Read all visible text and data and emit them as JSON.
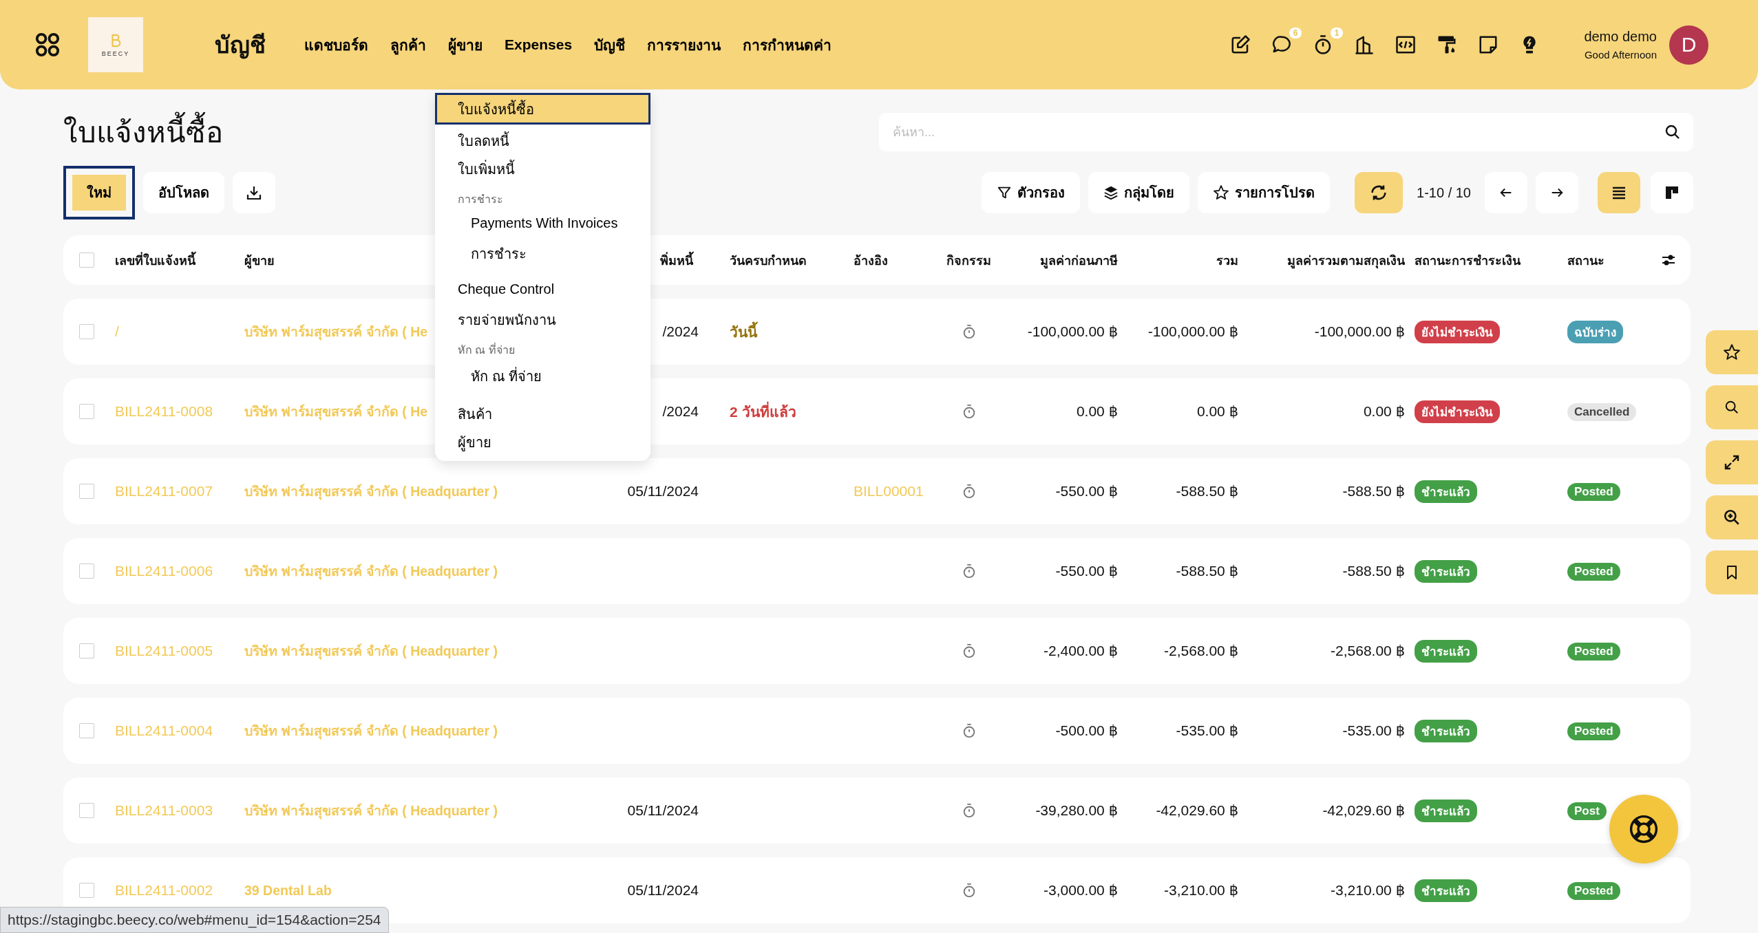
{
  "app_bar": {
    "logo_text": "BEECY",
    "app_name": "บัญชี",
    "nav": [
      {
        "label": "แดชบอร์ด"
      },
      {
        "label": "ลูกค้า"
      },
      {
        "label": "ผู้ขาย"
      },
      {
        "label": "Expenses"
      },
      {
        "label": "บัญชี"
      },
      {
        "label": "การรายงาน"
      },
      {
        "label": "การกำหนดค่า"
      }
    ],
    "tools": [
      {
        "kind": "edit"
      },
      {
        "kind": "chat",
        "badge": "6"
      },
      {
        "kind": "timer",
        "badge": "1"
      },
      {
        "kind": "building"
      },
      {
        "kind": "code"
      },
      {
        "kind": "roller"
      },
      {
        "kind": "note"
      },
      {
        "kind": "bulb"
      }
    ],
    "user": {
      "name": "demo demo",
      "greeting": "Good Afternoon",
      "initial": "D"
    }
  },
  "vendor_menu": [
    {
      "kind": "item",
      "label": "ใบแจ้งหนี้ซื้อ",
      "selected": true
    },
    {
      "kind": "item",
      "label": "ใบลดหนี้",
      "selected": false
    },
    {
      "kind": "item",
      "label": "ใบเพิ่มหนี้",
      "selected": false
    },
    {
      "kind": "section",
      "label": "การชำระ",
      "children": [
        {
          "label": "Payments With Invoices",
          "selected": false
        },
        {
          "label": "การชำระ",
          "selected": false
        }
      ]
    },
    {
      "kind": "item",
      "label": "Cheque Control",
      "selected": false
    },
    {
      "kind": "item",
      "label": "รายจ่ายพนักงาน",
      "selected": false
    },
    {
      "kind": "section",
      "label": "หัก ณ ที่จ่าย",
      "children": [
        {
          "label": "หัก ณ ที่จ่าย",
          "selected": false
        }
      ]
    },
    {
      "kind": "item",
      "label": "สินค้า",
      "selected": false
    },
    {
      "kind": "item",
      "label": "ผู้ขาย",
      "selected": false
    }
  ],
  "page": {
    "title": "ใบแจ้งหนี้ซื้อ",
    "new_button": {
      "label": "ใหม่",
      "focused": true
    },
    "upload_button": "อัปโหลด",
    "search": {
      "placeholder": "ค้นหา..."
    },
    "filter": "ตัวกรอง",
    "group_by": "กลุ่มโดย",
    "favorites": "รายการโปรด",
    "pager": "1-10 / 10",
    "views": [
      {
        "kind": "list",
        "selected": true
      },
      {
        "kind": "kanban",
        "selected": false
      }
    ]
  },
  "table": {
    "all_checked": false,
    "columns": [
      "เลขที่ใบแจ้งหนี้",
      "ผู้ขาย",
      "พิ่มหนี้",
      "วันครบกำหนด",
      "อ้างอิง",
      "กิจกรรม",
      "มูลค่าก่อนภาษี",
      "รวม",
      "มูลค่ารวมตามสกุลเงิน",
      "สถานะการชำระเงิน",
      "สถานะ"
    ],
    "rows": [
      {
        "checked": false,
        "number": "/",
        "vendor": "บริษัท ฟาร์มสุขสรรค์ จำกัด ( He",
        "date": "/2024",
        "due": {
          "text": "วันนี้",
          "color": "#94740f"
        },
        "untaxed": "-100,000.00 ฿",
        "total": "-100,000.00 ฿",
        "currency_total": "-100,000.00 ฿",
        "payment": {
          "label": "ยังไม่ชำระเงิน",
          "color": "#d1404a"
        },
        "status": {
          "label": "ฉบับร่าง",
          "color": "#4a9fb3"
        }
      },
      {
        "checked": false,
        "number": "BILL2411-0008",
        "vendor": "บริษัท ฟาร์มสุขสรรค์ จำกัด ( He",
        "date": "/2024",
        "due": {
          "text": "2 วันที่แล้ว",
          "color": "#cf3d3d"
        },
        "untaxed": "0.00 ฿",
        "total": "0.00 ฿",
        "currency_total": "0.00 ฿",
        "payment": {
          "label": "ยังไม่ชำระเงิน",
          "color": "#d1404a"
        },
        "status": {
          "label": "Cancelled",
          "color": "#e6e6e6"
        }
      },
      {
        "checked": false,
        "number": "BILL2411-0007",
        "vendor": "บริษัท ฟาร์มสุขสรรค์ จำกัด ( Headquarter )",
        "date": "05/11/2024",
        "reference": "BILL00001",
        "untaxed": "-550.00 ฿",
        "total": "-588.50 ฿",
        "currency_total": "-588.50 ฿",
        "payment": {
          "label": "ชำระแล้ว",
          "color": "#43a047"
        },
        "status": {
          "label": "Posted",
          "color": "#43a047"
        }
      },
      {
        "checked": false,
        "number": "BILL2411-0006",
        "vendor": "บริษัท ฟาร์มสุขสรรค์ จำกัด ( Headquarter )",
        "untaxed": "-550.00 ฿",
        "total": "-588.50 ฿",
        "currency_total": "-588.50 ฿",
        "payment": {
          "label": "ชำระแล้ว",
          "color": "#43a047"
        },
        "status": {
          "label": "Posted",
          "color": "#43a047"
        }
      },
      {
        "checked": false,
        "number": "BILL2411-0005",
        "vendor": "บริษัท ฟาร์มสุขสรรค์ จำกัด ( Headquarter )",
        "untaxed": "-2,400.00 ฿",
        "total": "-2,568.00 ฿",
        "currency_total": "-2,568.00 ฿",
        "payment": {
          "label": "ชำระแล้ว",
          "color": "#43a047"
        },
        "status": {
          "label": "Posted",
          "color": "#43a047"
        }
      },
      {
        "checked": false,
        "number": "BILL2411-0004",
        "vendor": "บริษัท ฟาร์มสุขสรรค์ จำกัด ( Headquarter )",
        "untaxed": "-500.00 ฿",
        "total": "-535.00 ฿",
        "currency_total": "-535.00 ฿",
        "payment": {
          "label": "ชำระแล้ว",
          "color": "#43a047"
        },
        "status": {
          "label": "Posted",
          "color": "#43a047"
        }
      },
      {
        "checked": false,
        "number": "BILL2411-0003",
        "vendor": "บริษัท ฟาร์มสุขสรรค์ จำกัด ( Headquarter )",
        "date": "05/11/2024",
        "untaxed": "-39,280.00 ฿",
        "total": "-42,029.60 ฿",
        "currency_total": "-42,029.60 ฿",
        "payment": {
          "label": "ชำระแล้ว",
          "color": "#43a047"
        },
        "status": {
          "label": "Post",
          "color": "#43a047"
        }
      },
      {
        "checked": false,
        "number": "BILL2411-0002",
        "vendor": "39 Dental Lab",
        "date": "05/11/2024",
        "untaxed": "-3,000.00 ฿",
        "total": "-3,210.00 ฿",
        "currency_total": "-3,210.00 ฿",
        "payment": {
          "label": "ชำระแล้ว",
          "color": "#43a047"
        },
        "status": {
          "label": "Posted",
          "color": "#43a047"
        }
      }
    ]
  },
  "side_actions": [
    {
      "kind": "star"
    },
    {
      "kind": "search"
    },
    {
      "kind": "expand"
    },
    {
      "kind": "zoom"
    },
    {
      "kind": "bookmark"
    }
  ],
  "status_url": "https://stagingbc.beecy.co/web#menu_id=154&action=254"
}
